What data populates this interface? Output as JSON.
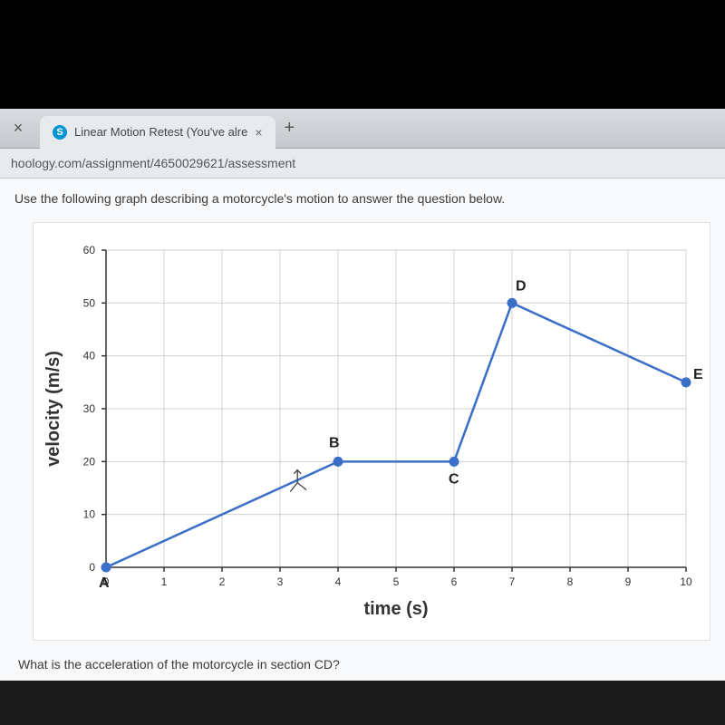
{
  "browser": {
    "tab_title": "Linear Motion Retest (You've alre",
    "favicon_letter": "S",
    "close_glyph": "×",
    "plus_glyph": "+",
    "url": "hoology.com/assignment/4650029621/assessment"
  },
  "page": {
    "intro_text": "Use the following graph describing a motorcycle's motion to answer the question below.",
    "question_text": "What is the acceleration of the motorcycle in section CD?"
  },
  "chart_data": {
    "type": "line",
    "xlabel": "time (s)",
    "ylabel": "velocity (m/s)",
    "xlim": [
      0,
      10
    ],
    "ylim": [
      0,
      60
    ],
    "x_ticks": [
      0,
      1,
      2,
      3,
      4,
      5,
      6,
      7,
      8,
      9,
      10
    ],
    "y_ticks": [
      0,
      10,
      20,
      30,
      40,
      50,
      60
    ],
    "points": [
      {
        "label": "A",
        "x": 0,
        "y": 0
      },
      {
        "label": "B",
        "x": 4,
        "y": 20
      },
      {
        "label": "C",
        "x": 6,
        "y": 20
      },
      {
        "label": "D",
        "x": 7,
        "y": 50
      },
      {
        "label": "E",
        "x": 10,
        "y": 35
      }
    ],
    "label_offsets": {
      "A": {
        "dx": -8,
        "dy": 22
      },
      "B": {
        "dx": -10,
        "dy": -16
      },
      "C": {
        "dx": -6,
        "dy": 24
      },
      "D": {
        "dx": 4,
        "dy": -14
      },
      "E": {
        "dx": 8,
        "dy": -4
      }
    }
  }
}
